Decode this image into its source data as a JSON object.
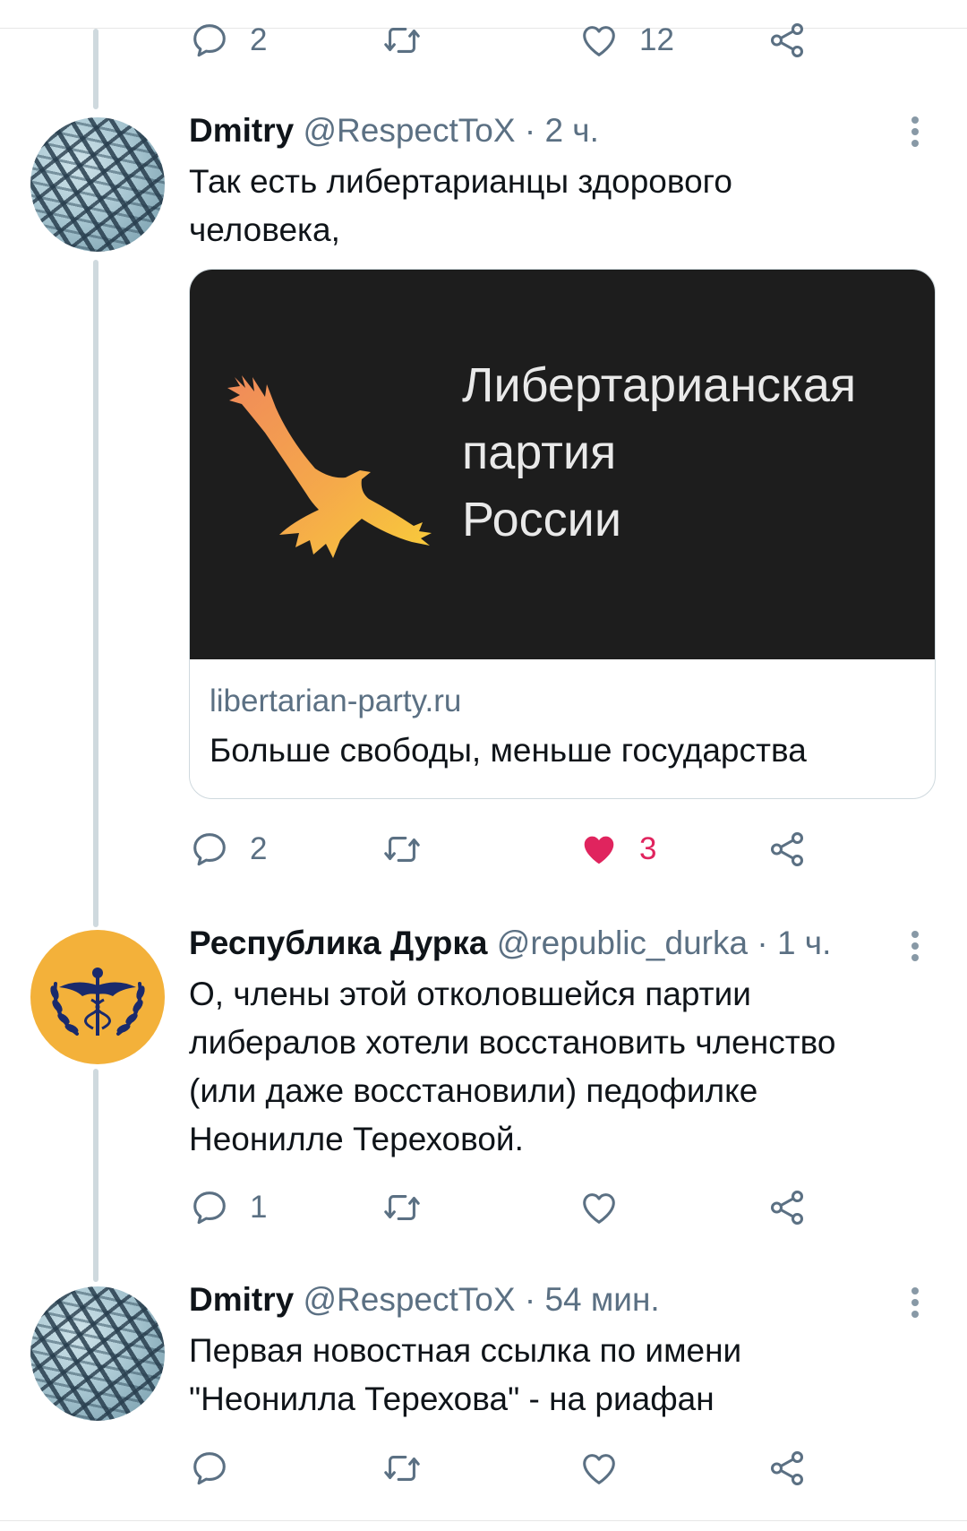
{
  "top_actions": {
    "reply_count": "2",
    "like_count": "12"
  },
  "tweets": [
    {
      "name": "Dmitry",
      "handle": "@RespectToX",
      "sep": "·",
      "time": "2 ч.",
      "text_lines": [
        "Так есть либертарианцы здорового",
        "человека,"
      ],
      "card": {
        "image_text": [
          "Либертарианская",
          "партия",
          "России"
        ],
        "domain": "libertarian-party.ru",
        "title": "Больше свободы, меньше государства"
      },
      "reply_count": "2",
      "retweet_count": "",
      "like_count": "3",
      "liked": true
    },
    {
      "name": "Республика Дурка",
      "handle": "@republic_durka",
      "sep": "·",
      "time": "1 ч.",
      "text_lines": [
        "О, члены этой отколовшейся партии",
        "либералов хотели восстановить членство",
        "(или даже восстановили) педофилке",
        "Неонилле Тереховой."
      ],
      "reply_count": "1",
      "retweet_count": "",
      "like_count": "",
      "liked": false
    },
    {
      "name": "Dmitry",
      "handle": "@RespectToX",
      "sep": "·",
      "time": "54 мин.",
      "text_lines": [
        "Первая новостная ссылка по имени",
        "\"Неонилла Терехова\" - на риафан"
      ],
      "reply_count": "",
      "retweet_count": "",
      "like_count": "",
      "liked": false
    }
  ],
  "colors": {
    "name": "#0f1419",
    "meta": "#5b7083",
    "like_active": "#e0245e",
    "thread_line": "#cfd9de",
    "card_bg": "#1d1d1d",
    "orange_avatar": "#f3b13a",
    "emblem_navy": "#1a2a6c"
  },
  "icons": [
    "reply-icon",
    "retweet-icon",
    "like-icon",
    "share-icon",
    "more-icon",
    "eagle-logo",
    "caduceus-emblem"
  ]
}
